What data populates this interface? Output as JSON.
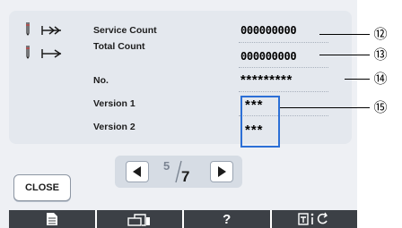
{
  "counts": {
    "service_label": "Service Count",
    "service_value": "000000000",
    "total_label": "Total Count",
    "total_value": "000000000"
  },
  "machine": {
    "no_label": "No.",
    "no_value": "*********",
    "version1_label": "Version 1",
    "version1_value": "***",
    "version2_label": "Version 2",
    "version2_value": "***"
  },
  "pager": {
    "current": "5",
    "total": "7"
  },
  "close_label": "CLOSE",
  "toolbar": {
    "help_label": "?"
  },
  "callouts": [
    "⑫",
    "⑬",
    "⑭",
    "⑮"
  ],
  "colors": {
    "version_highlight": "#2c6fd6",
    "toolbar_bg": "#3c4046"
  },
  "icons": [
    "single-needle-stitch-count-icon",
    "single-needle-total-icon",
    "document-icon",
    "embroidery-unit-icon",
    "sewing-machine-settings-icon",
    "prev-arrow-icon",
    "next-arrow-icon"
  ]
}
